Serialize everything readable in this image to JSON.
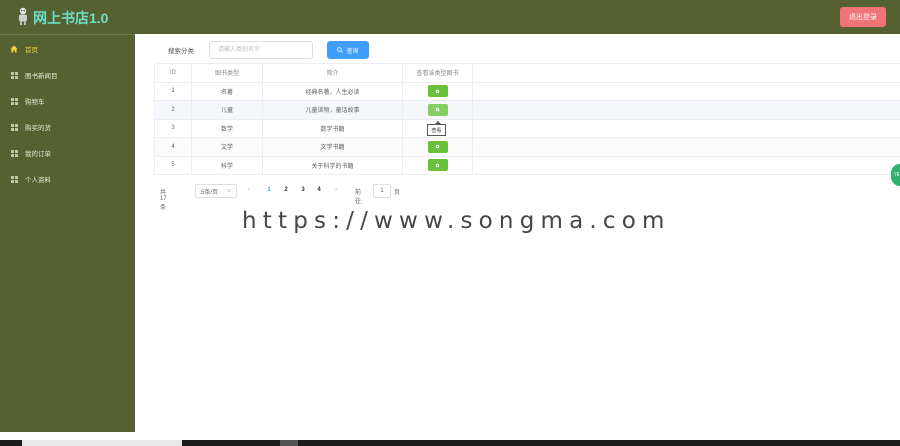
{
  "header": {
    "title": "网上书店1.0",
    "logout_label": "退出登录"
  },
  "sidebar": {
    "items": [
      {
        "label": "首页",
        "icon": "home-icon",
        "active": true
      },
      {
        "label": "图书新闻目",
        "icon": "grid-icon"
      },
      {
        "label": "购物车",
        "icon": "grid-icon"
      },
      {
        "label": "购买的货",
        "icon": "grid-icon"
      },
      {
        "label": "我的订单",
        "icon": "grid-icon"
      },
      {
        "label": "个人资料",
        "icon": "grid-icon"
      }
    ]
  },
  "search": {
    "label": "搜索分类",
    "placeholder": "请输入类别名字",
    "button_label": "查询"
  },
  "table": {
    "headers": [
      "ID",
      "图书类型",
      "简介",
      "查看该类型图书"
    ],
    "rows": [
      {
        "id": "1",
        "type": "名著",
        "desc": "经典名著，人生必读"
      },
      {
        "id": "2",
        "type": "儿童",
        "desc": "儿童读物，童话故事"
      },
      {
        "id": "3",
        "type": "数学",
        "desc": "数学书籍"
      },
      {
        "id": "4",
        "type": "文学",
        "desc": "文学书籍"
      },
      {
        "id": "5",
        "type": "科学",
        "desc": "关于科学的书籍"
      }
    ],
    "tooltip": "查看"
  },
  "pagination": {
    "total": "共 17 条",
    "page_size": "5条/页",
    "pages": [
      "1",
      "2",
      "3",
      "4"
    ],
    "current_page": "1",
    "goto_label": "前往",
    "goto_value": "1",
    "page_suffix": "页"
  },
  "watermark": "https://www.songma.com",
  "float_badge": "76"
}
